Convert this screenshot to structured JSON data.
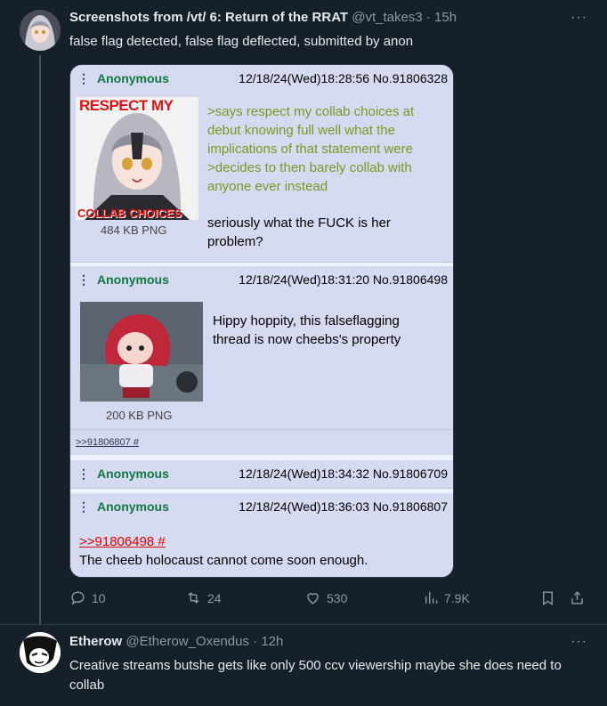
{
  "tweet": {
    "display_name": "Screenshots from /vt/ 6: Return of the RRAT",
    "handle": "@vt_takes3",
    "separator": "·",
    "time": "15h",
    "text": "false flag detected, false flag deflected, submitted by anon",
    "more_label": "···"
  },
  "screenshot": {
    "posts": [
      {
        "menu": "⋮",
        "name": "Anonymous",
        "meta": "12/18/24(Wed)18:28:56 No.91806328",
        "file_info": "484 KB PNG",
        "thumb_top_text": "RESPECT MY",
        "thumb_bottom_text": "COLLAB CHOICES",
        "greentext": ">says respect my collab choices at debut knowing full well what the implications of that statement were",
        "greentext2": ">decides to then barely collab with anyone ever instead",
        "body": "seriously what the FUCK is her problem?"
      },
      {
        "menu": "⋮",
        "name": "Anonymous",
        "meta": "12/18/24(Wed)18:31:20 No.91806498",
        "file_info": "200 KB PNG",
        "body": "Hippy hoppity, this falseflagging thread is now cheebs's property",
        "backlink": ">>91806807 #"
      },
      {
        "menu": "⋮",
        "name": "Anonymous",
        "meta": "12/18/24(Wed)18:34:32 No.91806709"
      },
      {
        "menu": "⋮",
        "name": "Anonymous",
        "meta": "12/18/24(Wed)18:36:03 No.91806807",
        "quote": ">>91806498 #",
        "body": "The cheeb holocaust cannot come soon enough."
      }
    ]
  },
  "actions": {
    "replies": "10",
    "retweets": "24",
    "likes": "530",
    "views": "7.9K"
  },
  "reply": {
    "display_name": "Etherow",
    "handle": "@Etherow_Oxendus",
    "separator": "·",
    "time": "12h",
    "text": "Creative streams butshe gets like only 500 ccv viewership maybe she does need to collab",
    "more_label": "···"
  },
  "colors": {
    "background": "#15202b",
    "post_bg": "#d6daf0",
    "anon_name": "#117743",
    "greentext": "#789922",
    "quotelink": "#dd0000"
  }
}
